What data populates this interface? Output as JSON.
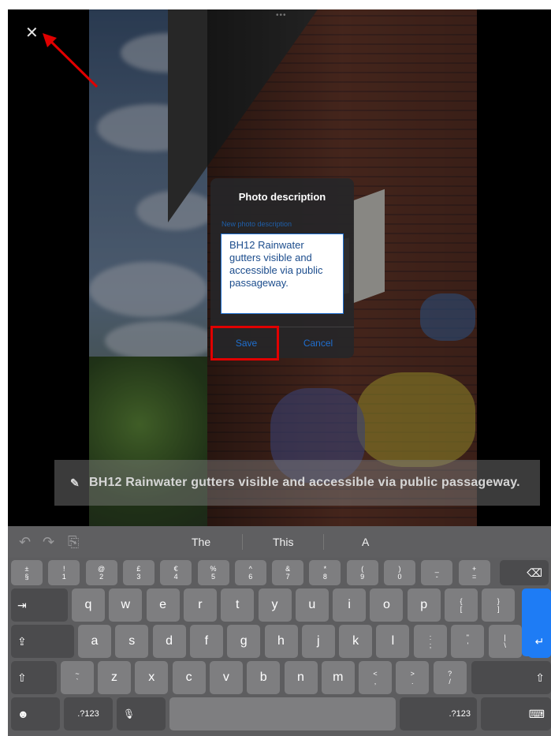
{
  "viewer": {
    "close_icon": "close-icon",
    "handle_dots": "•••"
  },
  "caption": {
    "text": "BH12 Rainwater gutters visible and accessible via public passageway.",
    "edit_icon": "pencil-icon"
  },
  "dialog": {
    "title": "Photo description",
    "field_label": "New photo description",
    "value": "BH12 Rainwater gutters visible and accessible via public passageway.",
    "save_label": "Save",
    "cancel_label": "Cancel"
  },
  "keyboard": {
    "suggestions": [
      "The",
      "This",
      "A"
    ],
    "number_row": [
      {
        "top": "±",
        "bottom": "§"
      },
      {
        "top": "!",
        "bottom": "1"
      },
      {
        "top": "@",
        "bottom": "2"
      },
      {
        "top": "£",
        "bottom": "3"
      },
      {
        "top": "€",
        "bottom": "4"
      },
      {
        "top": "%",
        "bottom": "5"
      },
      {
        "top": "^",
        "bottom": "6"
      },
      {
        "top": "&",
        "bottom": "7"
      },
      {
        "top": "*",
        "bottom": "8"
      },
      {
        "top": "(",
        "bottom": "9"
      },
      {
        "top": ")",
        "bottom": "0"
      },
      {
        "top": "_",
        "bottom": "-"
      },
      {
        "top": "+",
        "bottom": "="
      }
    ],
    "row_q": [
      "q",
      "w",
      "e",
      "r",
      "t",
      "y",
      "u",
      "i",
      "o",
      "p"
    ],
    "row_q_extra": [
      {
        "top": "{",
        "bottom": "["
      },
      {
        "top": "}",
        "bottom": "]"
      }
    ],
    "row_a": [
      "a",
      "s",
      "d",
      "f",
      "g",
      "h",
      "j",
      "k",
      "l"
    ],
    "row_a_extra": [
      {
        "top": ":",
        "bottom": ";"
      },
      {
        "top": "\"",
        "bottom": "'"
      },
      {
        "top": "|",
        "bottom": "\\"
      }
    ],
    "row_z": [
      "z",
      "x",
      "c",
      "v",
      "b",
      "n",
      "m"
    ],
    "row_z_extra_before": {
      "top": "~",
      "bottom": "`"
    },
    "row_z_extra": [
      {
        "top": "<",
        "bottom": ","
      },
      {
        "top": ">",
        "bottom": "."
      },
      {
        "top": "?",
        "bottom": "/"
      }
    ],
    "mode_label_left": ".?123",
    "mode_label_right": ".?123",
    "tab_icon": "⇥",
    "caps_icon": "⇪",
    "shift_icon": "⇧",
    "delete_icon": "⌫",
    "return_icon": "↵",
    "emoji_icon": "☻",
    "mic_icon": "🎙",
    "hide_keyboard_icon": "⌨",
    "accent_color": "#1e7cf5"
  },
  "annotation": {
    "arrow_color": "#e00000",
    "box_color": "#e00000"
  }
}
